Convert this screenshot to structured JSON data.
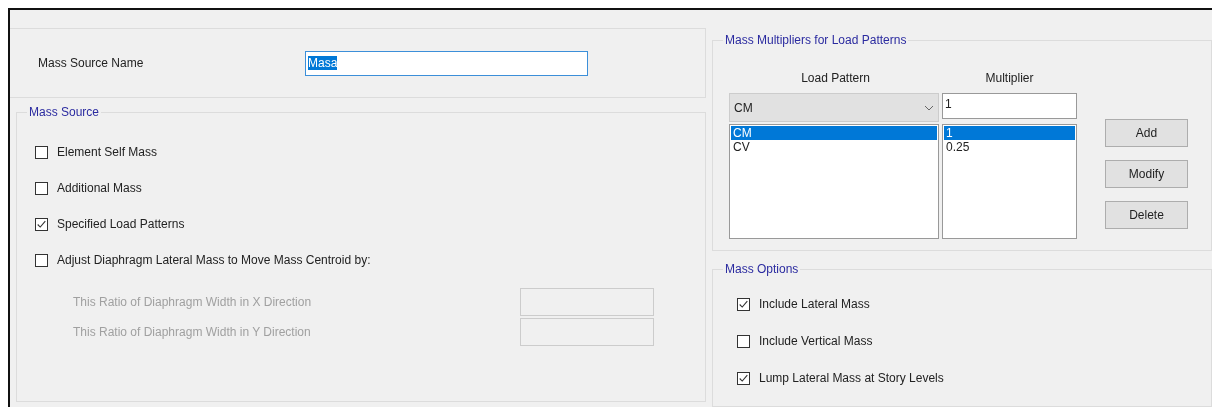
{
  "mass_source_name": {
    "label": "Mass Source Name",
    "value": "Masa",
    "selected": true
  },
  "mass_source": {
    "title": "Mass Source",
    "options": [
      {
        "label": "Element Self Mass",
        "checked": false
      },
      {
        "label": "Additional Mass",
        "checked": false
      },
      {
        "label": "Specified Load Patterns",
        "checked": true
      },
      {
        "label": "Adjust Diaphragm Lateral Mass to Move Mass Centroid by:",
        "checked": false
      }
    ],
    "ratio_fields": [
      {
        "label": "This Ratio of Diaphragm Width in X Direction",
        "disabled": true
      },
      {
        "label": "This Ratio of Diaphragm Width in Y Direction",
        "disabled": true
      }
    ]
  },
  "mass_multipliers": {
    "title": "Mass Multipliers for Load Patterns",
    "columns": [
      "Load Pattern",
      "Multiplier"
    ],
    "load_pattern_dropdown": {
      "value": "CM"
    },
    "multiplier_field": {
      "value": "1"
    },
    "rows": [
      {
        "load_pattern": "CM",
        "multiplier": "1",
        "selected": true
      },
      {
        "load_pattern": "CV",
        "multiplier": "0.25",
        "selected": false
      }
    ],
    "buttons": [
      "Add",
      "Modify",
      "Delete"
    ]
  },
  "mass_options": {
    "title": "Mass Options",
    "options": [
      {
        "label": "Include Lateral Mass",
        "checked": true
      },
      {
        "label": "Include Vertical Mass",
        "checked": false
      },
      {
        "label": "Lump Lateral Mass at Story Levels",
        "checked": true
      }
    ]
  }
}
